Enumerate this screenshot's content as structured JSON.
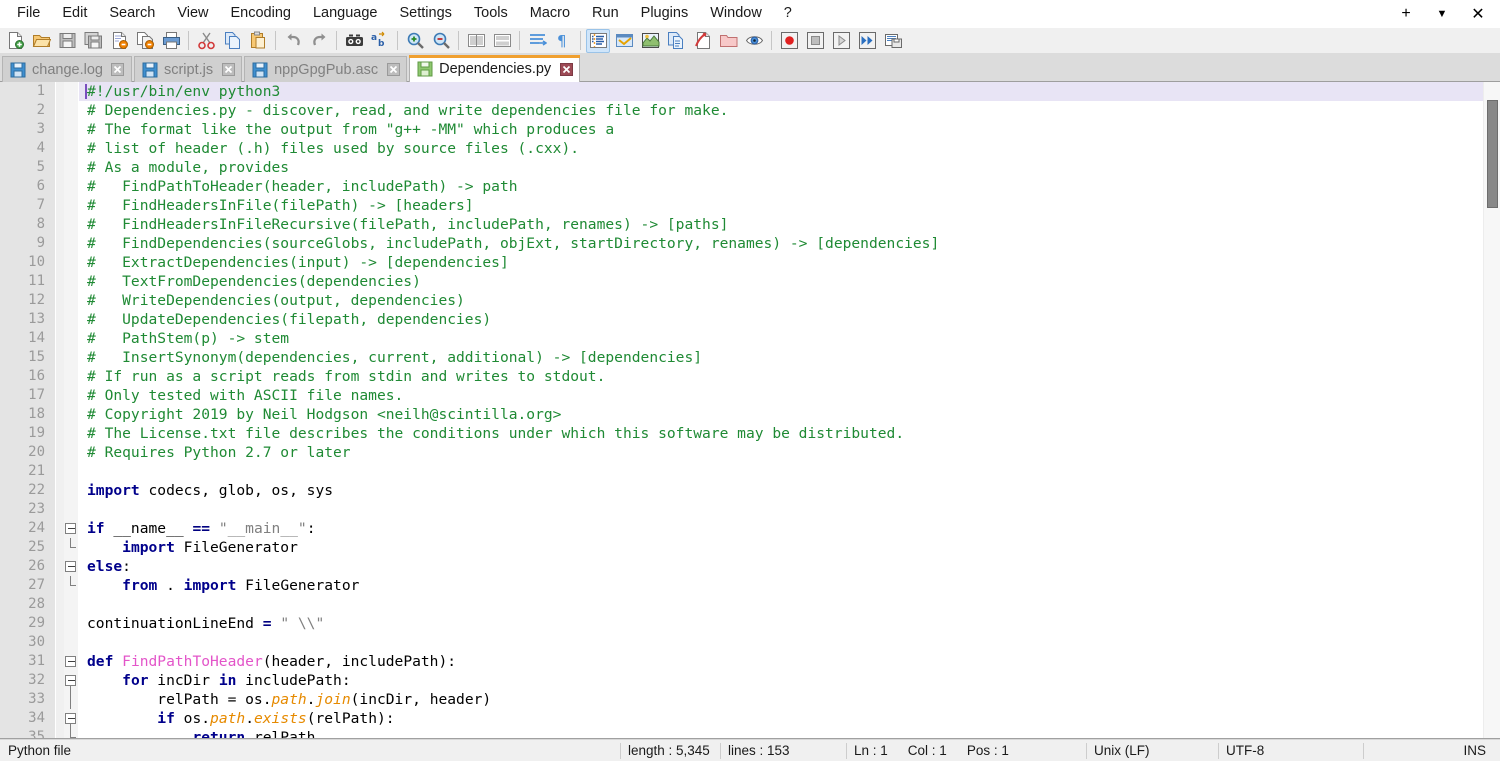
{
  "menu": {
    "items": [
      {
        "label": "File"
      },
      {
        "label": "Edit"
      },
      {
        "label": "Search"
      },
      {
        "label": "View"
      },
      {
        "label": "Encoding"
      },
      {
        "label": "Language"
      },
      {
        "label": "Settings"
      },
      {
        "label": "Tools"
      },
      {
        "label": "Macro"
      },
      {
        "label": "Run"
      },
      {
        "label": "Plugins"
      },
      {
        "label": "Window"
      },
      {
        "label": "?"
      }
    ],
    "window_controls": [
      {
        "name": "add-tab-button",
        "glyph": "+"
      },
      {
        "name": "tab-list-dropdown",
        "glyph": "▼"
      },
      {
        "name": "close-window-button",
        "glyph": "✕"
      }
    ]
  },
  "toolbar": {
    "groups": [
      [
        "new-file",
        "open-file",
        "save-file",
        "save-all",
        "close-file",
        "close-all",
        "print"
      ],
      [
        "cut",
        "copy",
        "paste"
      ],
      [
        "undo",
        "redo"
      ],
      [
        "find",
        "replace"
      ],
      [
        "zoom-in",
        "zoom-out"
      ],
      [
        "sync-vertical-scrolling",
        "sync-horizontal-scrolling"
      ],
      [
        "word-wrap",
        "show-all-characters"
      ],
      [
        "show-indent-guide",
        "show-ui-user-defined-dialog",
        "document-map",
        "document-list",
        "function-list",
        "folder-as-workspace",
        "monitoring"
      ],
      [
        "macro-record",
        "macro-stop",
        "macro-play",
        "macro-play-multiple",
        "macro-save"
      ]
    ],
    "active_button": "show-indent-guide"
  },
  "tabs": [
    {
      "label": "change.log",
      "active": false,
      "modified": false
    },
    {
      "label": "script.js",
      "active": false,
      "modified": false
    },
    {
      "label": "nppGpgPub.asc",
      "active": false,
      "modified": false
    },
    {
      "label": "Dependencies.py",
      "active": true,
      "modified": false
    }
  ],
  "editor": {
    "first_line": 1,
    "last_line": 35,
    "current_line": 1,
    "lines": [
      {
        "n": 1,
        "fold": "none",
        "tokens": [
          {
            "t": "caret",
            "v": ""
          },
          {
            "t": "cm",
            "v": "#!/usr/bin/env python3"
          }
        ]
      },
      {
        "n": 2,
        "fold": "none",
        "tokens": [
          {
            "t": "cm",
            "v": "# Dependencies.py - discover, read, and write dependencies file for make."
          }
        ]
      },
      {
        "n": 3,
        "fold": "none",
        "tokens": [
          {
            "t": "cm",
            "v": "# The format like the output from \"g++ -MM\" which produces a"
          }
        ]
      },
      {
        "n": 4,
        "fold": "none",
        "tokens": [
          {
            "t": "cm",
            "v": "# list of header (.h) files used by source files (.cxx)."
          }
        ]
      },
      {
        "n": 5,
        "fold": "none",
        "tokens": [
          {
            "t": "cm",
            "v": "# As a module, provides"
          }
        ]
      },
      {
        "n": 6,
        "fold": "none",
        "tokens": [
          {
            "t": "cm",
            "v": "#   FindPathToHeader(header, includePath) -> path"
          }
        ]
      },
      {
        "n": 7,
        "fold": "none",
        "tokens": [
          {
            "t": "cm",
            "v": "#   FindHeadersInFile(filePath) -> [headers]"
          }
        ]
      },
      {
        "n": 8,
        "fold": "none",
        "tokens": [
          {
            "t": "cm",
            "v": "#   FindHeadersInFileRecursive(filePath, includePath, renames) -> [paths]"
          }
        ]
      },
      {
        "n": 9,
        "fold": "none",
        "tokens": [
          {
            "t": "cm",
            "v": "#   FindDependencies(sourceGlobs, includePath, objExt, startDirectory, renames) -> [dependencies]"
          }
        ]
      },
      {
        "n": 10,
        "fold": "none",
        "tokens": [
          {
            "t": "cm",
            "v": "#   ExtractDependencies(input) -> [dependencies]"
          }
        ]
      },
      {
        "n": 11,
        "fold": "none",
        "tokens": [
          {
            "t": "cm",
            "v": "#   TextFromDependencies(dependencies)"
          }
        ]
      },
      {
        "n": 12,
        "fold": "none",
        "tokens": [
          {
            "t": "cm",
            "v": "#   WriteDependencies(output, dependencies)"
          }
        ]
      },
      {
        "n": 13,
        "fold": "none",
        "tokens": [
          {
            "t": "cm",
            "v": "#   UpdateDependencies(filepath, dependencies)"
          }
        ]
      },
      {
        "n": 14,
        "fold": "none",
        "tokens": [
          {
            "t": "cm",
            "v": "#   PathStem(p) -> stem"
          }
        ]
      },
      {
        "n": 15,
        "fold": "none",
        "tokens": [
          {
            "t": "cm",
            "v": "#   InsertSynonym(dependencies, current, additional) -> [dependencies]"
          }
        ]
      },
      {
        "n": 16,
        "fold": "none",
        "tokens": [
          {
            "t": "cm",
            "v": "# If run as a script reads from stdin and writes to stdout."
          }
        ]
      },
      {
        "n": 17,
        "fold": "none",
        "tokens": [
          {
            "t": "cm",
            "v": "# Only tested with ASCII file names."
          }
        ]
      },
      {
        "n": 18,
        "fold": "none",
        "tokens": [
          {
            "t": "cm",
            "v": "# Copyright 2019 by Neil Hodgson <neilh@scintilla.org>"
          }
        ]
      },
      {
        "n": 19,
        "fold": "none",
        "tokens": [
          {
            "t": "cm",
            "v": "# The License.txt file describes the conditions under which this software may be distributed."
          }
        ]
      },
      {
        "n": 20,
        "fold": "none",
        "tokens": [
          {
            "t": "cm",
            "v": "# Requires Python 2.7 or later"
          }
        ]
      },
      {
        "n": 21,
        "fold": "none",
        "tokens": []
      },
      {
        "n": 22,
        "fold": "none",
        "tokens": [
          {
            "t": "kw",
            "v": "import"
          },
          {
            "t": "ident",
            "v": " codecs, glob, os, sys"
          }
        ]
      },
      {
        "n": 23,
        "fold": "none",
        "tokens": []
      },
      {
        "n": 24,
        "fold": "box",
        "tokens": [
          {
            "t": "kw",
            "v": "if"
          },
          {
            "t": "ident",
            "v": " __name__ "
          },
          {
            "t": "op",
            "v": "=="
          },
          {
            "t": "ident",
            "v": " "
          },
          {
            "t": "str",
            "v": "\"__main__\""
          },
          {
            "t": "ident",
            "v": ":"
          }
        ]
      },
      {
        "n": 25,
        "fold": "end",
        "tokens": [
          {
            "t": "ident",
            "v": "    "
          },
          {
            "t": "kw",
            "v": "import"
          },
          {
            "t": "ident",
            "v": " FileGenerator"
          }
        ]
      },
      {
        "n": 26,
        "fold": "box",
        "tokens": [
          {
            "t": "kw",
            "v": "else"
          },
          {
            "t": "ident",
            "v": ":"
          }
        ]
      },
      {
        "n": 27,
        "fold": "end",
        "tokens": [
          {
            "t": "ident",
            "v": "    "
          },
          {
            "t": "kw",
            "v": "from"
          },
          {
            "t": "ident",
            "v": " . "
          },
          {
            "t": "kw",
            "v": "import"
          },
          {
            "t": "ident",
            "v": " FileGenerator"
          }
        ]
      },
      {
        "n": 28,
        "fold": "none",
        "tokens": []
      },
      {
        "n": 29,
        "fold": "none",
        "tokens": [
          {
            "t": "ident",
            "v": "continuationLineEnd "
          },
          {
            "t": "op",
            "v": "="
          },
          {
            "t": "ident",
            "v": " "
          },
          {
            "t": "str",
            "v": "\" \\\\\""
          }
        ]
      },
      {
        "n": 30,
        "fold": "none",
        "tokens": []
      },
      {
        "n": 31,
        "fold": "box",
        "tokens": [
          {
            "t": "kw",
            "v": "def"
          },
          {
            "t": "ident",
            "v": " "
          },
          {
            "t": "fn",
            "v": "FindPathToHeader"
          },
          {
            "t": "ident",
            "v": "(header, includePath):"
          }
        ]
      },
      {
        "n": 32,
        "fold": "box2",
        "tokens": [
          {
            "t": "ident",
            "v": "    "
          },
          {
            "t": "kw",
            "v": "for"
          },
          {
            "t": "ident",
            "v": " incDir "
          },
          {
            "t": "kw",
            "v": "in"
          },
          {
            "t": "ident",
            "v": " includePath:"
          }
        ]
      },
      {
        "n": 33,
        "fold": "line",
        "tokens": [
          {
            "t": "ident",
            "v": "        relPath = os."
          },
          {
            "t": "inst",
            "v": "path"
          },
          {
            "t": "ident",
            "v": "."
          },
          {
            "t": "inst",
            "v": "join"
          },
          {
            "t": "ident",
            "v": "(incDir, header)"
          }
        ]
      },
      {
        "n": 34,
        "fold": "box2",
        "tokens": [
          {
            "t": "ident",
            "v": "        "
          },
          {
            "t": "kw",
            "v": "if"
          },
          {
            "t": "ident",
            "v": " os."
          },
          {
            "t": "inst",
            "v": "path"
          },
          {
            "t": "ident",
            "v": "."
          },
          {
            "t": "inst",
            "v": "exists"
          },
          {
            "t": "ident",
            "v": "(relPath):"
          }
        ]
      },
      {
        "n": 35,
        "fold": "end",
        "tokens": [
          {
            "t": "ident",
            "v": "            "
          },
          {
            "t": "kw",
            "v": "return"
          },
          {
            "t": "ident",
            "v": " relPath"
          }
        ]
      }
    ]
  },
  "statusbar": {
    "doc_type": "Python file",
    "length_label": "length : 5,345",
    "lines_label": "lines : 153",
    "ln": "Ln : 1",
    "col": "Col : 1",
    "pos": "Pos : 1",
    "eol": "Unix (LF)",
    "encoding": "UTF-8",
    "insert_mode": "INS"
  },
  "colors": {
    "comment": "#1f8a34",
    "keyword": "#00008b",
    "function": "#e355c9",
    "string": "#808080",
    "instance": "#e68a00",
    "active_tab_accent": "#f0a030",
    "current_line": "#e8e4f5",
    "caret": "#7a4fbf"
  }
}
